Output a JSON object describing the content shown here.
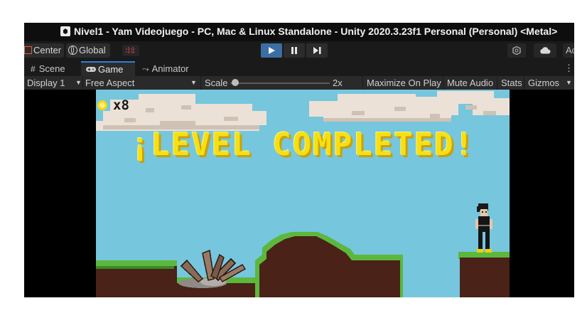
{
  "window": {
    "title": "Nivel1 - Yam Videojuego - PC, Mac & Linux Standalone - Unity 2020.3.23f1 Personal (Personal) <Metal>"
  },
  "toolbar": {
    "pivot_label": "Center",
    "space_label": "Global",
    "account_label": "Ac"
  },
  "tabs": [
    {
      "label": "Scene",
      "icon": "grid-icon"
    },
    {
      "label": "Game",
      "icon": "gamepad-icon"
    },
    {
      "label": "Animator",
      "icon": "animator-icon"
    }
  ],
  "game_toolbar": {
    "display": "Display 1",
    "aspect": "Free Aspect",
    "scale_label": "Scale",
    "scale_value": "2x",
    "maximize": "Maximize On Play",
    "mute": "Mute Audio",
    "stats": "Stats",
    "gizmos": "Gizmos"
  },
  "game": {
    "coin_count": "x8",
    "message": "¡LEVEL COMPLETED!"
  },
  "colors": {
    "accent": "#3b6ea3",
    "sky": "#76c6de",
    "grass": "#5cb83c",
    "dirt": "#4a2218",
    "banner": "#f6e015"
  }
}
